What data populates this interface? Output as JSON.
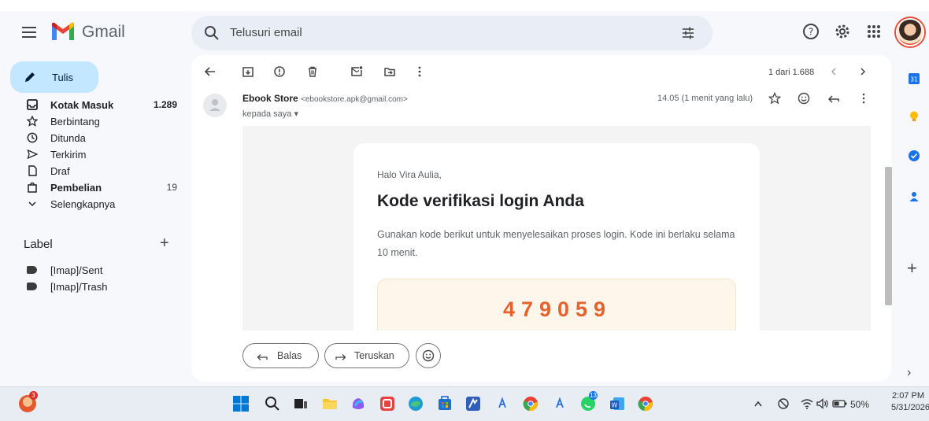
{
  "header": {
    "brand": "Gmail",
    "search_placeholder": "Telusuri email"
  },
  "compose": {
    "label": "Tulis"
  },
  "nav": {
    "items": [
      {
        "label": "Kotak Masuk",
        "count": "1.289",
        "bold": true,
        "icon": "inbox-icon"
      },
      {
        "label": "Berbintang",
        "count": "",
        "icon": "star-icon"
      },
      {
        "label": "Ditunda",
        "count": "",
        "icon": "clock-icon"
      },
      {
        "label": "Terkirim",
        "count": "",
        "icon": "send-icon"
      },
      {
        "label": "Draf",
        "count": "",
        "icon": "file-icon"
      },
      {
        "label": "Pembelian",
        "count": "19",
        "bold": true,
        "icon": "shopping-bag-icon"
      },
      {
        "label": "Selengkapnya",
        "count": "",
        "icon": "chevron-down-icon"
      }
    ],
    "labels_title": "Label",
    "labels": [
      "[Imap]/Sent",
      "[Imap]/Trash"
    ]
  },
  "toolbar": {
    "pagination": "1 dari 1.688"
  },
  "message": {
    "sender_name": "Ebook Store",
    "sender_email": "<ebookstore.apk@gmail.com>",
    "to": "kepada saya",
    "time": "14.05 (1 menit yang lalu)",
    "greeting": "Halo Vira Aulia,",
    "heading": "Kode verifikasi login Anda",
    "body": "Gunakan kode berikut untuk menyelesaikan proses login. Kode ini berlaku selama 10 menit.",
    "code": "479059"
  },
  "reply": {
    "reply_label": "Balas",
    "forward_label": "Teruskan"
  },
  "taskbar": {
    "battery": "50%",
    "time": "2:07 PM",
    "date": "5/31/2026",
    "badge_left": "3",
    "badge_whatsapp": "13"
  }
}
